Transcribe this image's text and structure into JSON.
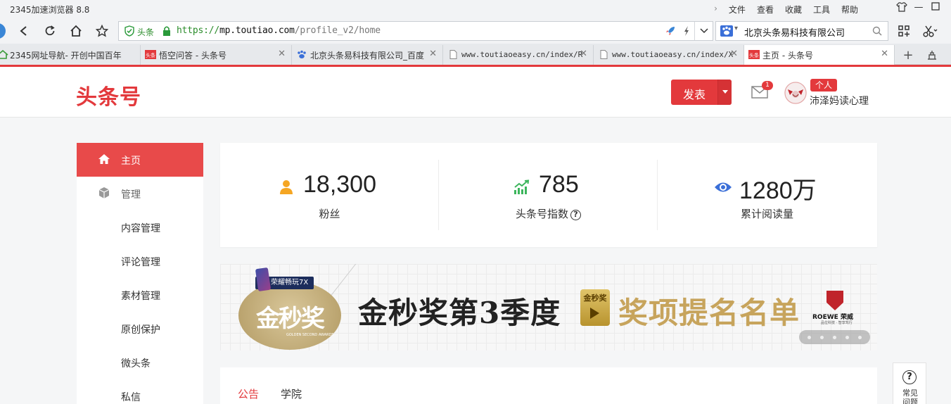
{
  "browser": {
    "title": "2345加速浏览器 8.8",
    "menus": [
      "文件",
      "查看",
      "收藏",
      "工具",
      "帮助"
    ],
    "address": {
      "site_label": "头条",
      "protocol": "https://",
      "host": "mp.toutiao.com",
      "path": "/profile_v2/home"
    },
    "search_query": "北京头条易科技有限公司",
    "tabs": [
      {
        "title": "2345网址导航- 开创中国百年",
        "mono": false
      },
      {
        "title": "悟空问答 - 头条号",
        "mono": false
      },
      {
        "title": "北京头条易科技有限公司_百度",
        "mono": false
      },
      {
        "title": "www.toutiaoeasy.cn/index/R",
        "mono": true
      },
      {
        "title": "www.toutiaoeasy.cn/index/X",
        "mono": true
      },
      {
        "title": "主页 - 头条号",
        "mono": false
      }
    ]
  },
  "header": {
    "logo": "头条号",
    "publish_label": "发表",
    "mail_count": "1",
    "user_badge": "个人",
    "username": "沛泽妈读心理"
  },
  "sidebar": {
    "items": [
      {
        "label": "主页",
        "active": true
      },
      {
        "label": "管理",
        "group": true
      },
      {
        "label": "内容管理"
      },
      {
        "label": "评论管理"
      },
      {
        "label": "素材管理"
      },
      {
        "label": "原创保护"
      },
      {
        "label": "微头条"
      },
      {
        "label": "私信"
      }
    ]
  },
  "stats": [
    {
      "value": "18,300",
      "label": "粉丝",
      "icon": "person-icon",
      "color": "#f5a623"
    },
    {
      "value": "785",
      "label": "头条号指数",
      "icon": "trend-chart-icon",
      "color": "#3cb55c",
      "help": "?"
    },
    {
      "value": "1280万",
      "label": "累计阅读量",
      "icon": "eye-icon",
      "color": "#3b6fd8"
    }
  ],
  "banner": {
    "medal_text": "金秒奖",
    "medal_sub": "GOLDEN SECOND AWARDS",
    "sponsor_badge": "荣耀畅玩7X",
    "headline_left": "金秒奖第3季度",
    "trophy_text": "金秒奖",
    "headline_right": "奖项提名名单",
    "brand": "ROEWE 荣威",
    "brand_slogan": "品位科技 · 智享驾行",
    "slide_count": 5
  },
  "notices": {
    "tabs": [
      "公告",
      "学院"
    ],
    "active": 0
  },
  "help": {
    "label": "常见问题"
  },
  "colors": {
    "accent": "#e3393c",
    "background": "#f5f6f7"
  }
}
